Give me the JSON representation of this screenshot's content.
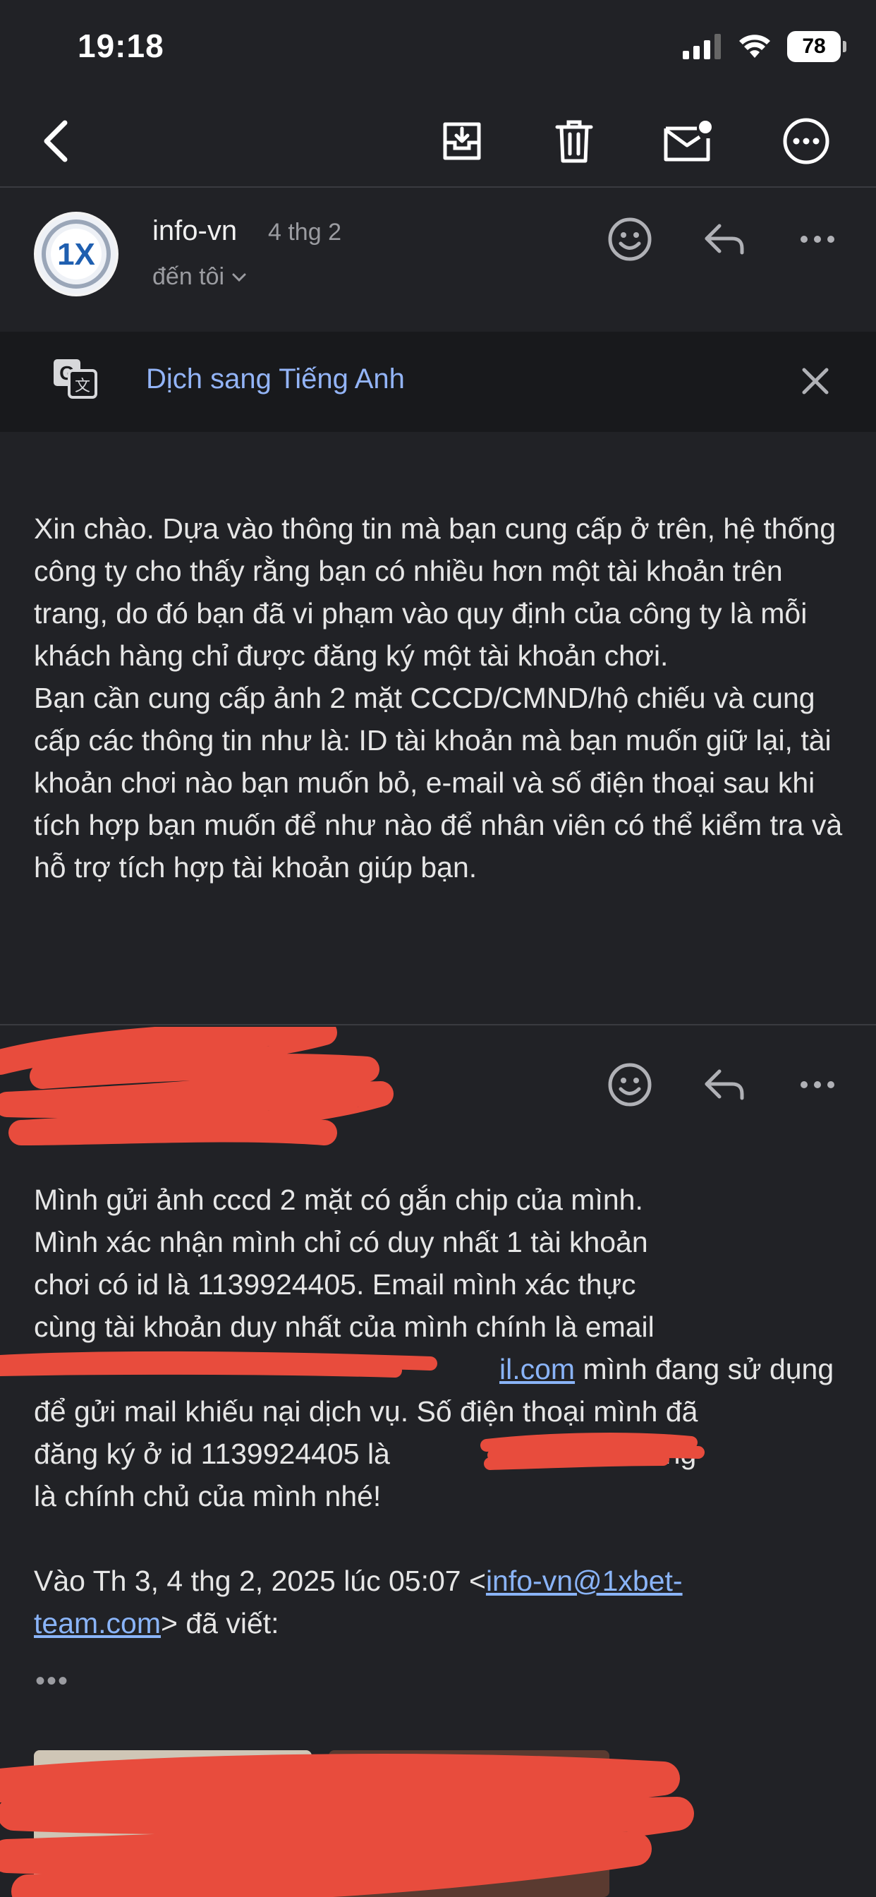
{
  "status_bar": {
    "time": "19:18",
    "battery": "78"
  },
  "toolbar": {
    "back": "back-icon",
    "archive": "archive-icon",
    "delete": "trash-icon",
    "mark_unread": "mail-unread-icon",
    "more": "more-horizontal-icon"
  },
  "message1": {
    "sender": "info-vn",
    "date": "4 thg 2",
    "recipient": "đến tôi",
    "avatar_text": "1X",
    "body": "Xin chào. Dựa vào thông tin mà bạn cung cấp ở trên, hệ thống công ty cho thấy rằng bạn có nhiều hơn một tài khoản trên trang, do đó bạn đã vi phạm vào quy định của công ty là mỗi khách hàng chỉ được đăng ký một tài khoản chơi.\nBạn cần cung cấp ảnh 2 mặt CCCD/CMND/hộ chiếu và cung cấp các thông tin như là: ID tài khoản mà bạn muốn giữ lại, tài khoản chơi nào bạn muốn bỏ, e-mail và số điện thoại sau khi tích hợp bạn muốn để như nào để nhân viên có thể kiểm tra và hỗ trợ tích hợp tài khoản giúp bạn."
  },
  "translate_banner": {
    "label": "Dịch sang Tiếng Anh"
  },
  "message2": {
    "line1": "Mình gửi ảnh cccd 2 mặt có gắn chip của mình.",
    "line2": "Mình xác nhận mình chỉ có duy nhất 1 tài khoản",
    "line3": "chơi có id là 1139924405. Email mình xác thực",
    "line4": "cùng tài khoản duy nhất của mình chính là email",
    "email_tail": "il.com",
    "line5_rest": " mình đang sử dụng",
    "line6": "để gửi mail khiếu nại dịch vụ. Số điện thoại mình đã",
    "line7_start": "đăng ký ở id 1139924405 là ",
    "line7_end": "3 cũng",
    "line8": "là chính chủ của mình nhé!",
    "quote_prefix": "Vào Th 3, 4 thg 2, 2025 lúc 05:07 <",
    "quote_email_part1": "info-vn@1xbet-",
    "quote_email_part2": "team.com",
    "quote_suffix": "> đã viết:",
    "quoted_more": "•••"
  }
}
